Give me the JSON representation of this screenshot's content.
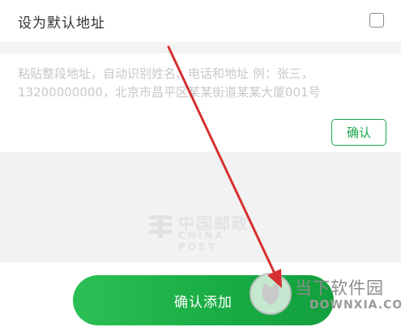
{
  "default_address": {
    "label": "设为默认地址",
    "checked": false
  },
  "paste": {
    "placeholder": "粘贴整段地址，自动识别姓名、电话和地址 例：张三，13200000000，北京市昌平区某某街道某某大厦001号",
    "confirm_label": "确认"
  },
  "watermark": {
    "text_cn": "中国邮政",
    "text_en": "CHINA POST"
  },
  "primary_action": {
    "label": "确认添加"
  },
  "site_watermark": {
    "brand": "当下软件园",
    "domain": "DOWNXIA.COM"
  },
  "colors": {
    "accent_green": "#1aa84a",
    "annotation_arrow": "#d63030",
    "placeholder_gray": "#c8c8c8"
  }
}
